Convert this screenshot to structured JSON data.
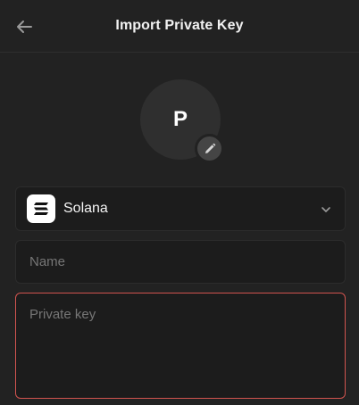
{
  "header": {
    "title": "Import Private Key",
    "back_icon": "arrow-left-icon"
  },
  "avatar": {
    "letter": "P",
    "edit_icon": "pencil-icon"
  },
  "network_select": {
    "selected": "Solana",
    "logo_icon": "solana-logo-icon",
    "chevron_icon": "chevron-down-icon"
  },
  "name_input": {
    "value": "",
    "placeholder": "Name"
  },
  "private_key_input": {
    "value": "",
    "placeholder": "Private key",
    "border_color": "#d1544f"
  },
  "colors": {
    "background": "#222222",
    "field_background": "#1c1c1c",
    "error_border": "#d1544f"
  }
}
